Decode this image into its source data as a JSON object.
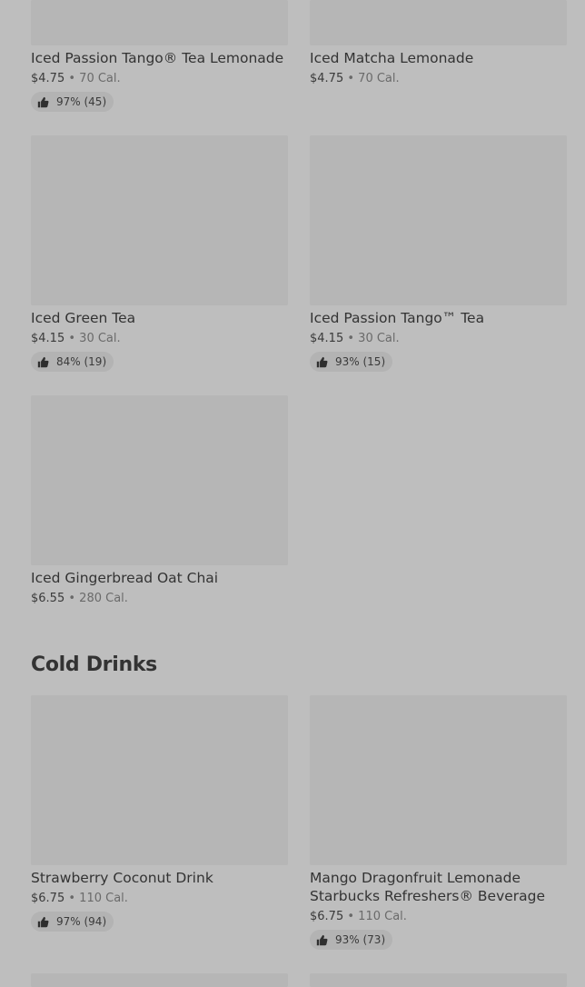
{
  "products_top": [
    {
      "name": "Iced Passion Tango® Tea Lemonade",
      "price": "$4.75",
      "calories": "70 Cal.",
      "rating": "97% (45)"
    },
    {
      "name": "Iced Matcha Lemonade",
      "price": "$4.75",
      "calories": "70 Cal."
    },
    {
      "name": "Iced Green Tea",
      "price": "$4.15",
      "calories": "30 Cal.",
      "rating": "84% (19)"
    },
    {
      "name": "Iced Passion Tango™ Tea",
      "price": "$4.15",
      "calories": "30 Cal.",
      "rating": "93% (15)"
    },
    {
      "name": "Iced Gingerbread Oat Chai",
      "price": "$6.55",
      "calories": "280 Cal."
    }
  ],
  "cold_drinks": {
    "title": "Cold Drinks",
    "items": [
      {
        "name": "Strawberry Coconut Drink",
        "price": "$6.75",
        "calories": "110 Cal.",
        "rating": "97% (94)"
      },
      {
        "name": "Mango Dragonfruit Lemonade Starbucks Refreshers® Beverage",
        "price": "$6.75",
        "calories": "110 Cal.",
        "rating": "93% (73)"
      }
    ]
  },
  "separator": "•",
  "icons": {
    "rating": "thumbs-up-icon"
  }
}
